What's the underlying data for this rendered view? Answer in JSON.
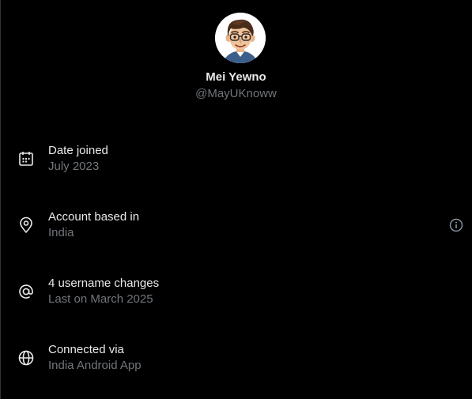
{
  "profile": {
    "display_name": "Mei Yewno",
    "handle": "@MayUKnoww",
    "avatar_icon": "cartoon-avatar"
  },
  "rows": [
    {
      "icon": "calendar-icon",
      "title": "Date joined",
      "subtitle": "July 2023"
    },
    {
      "icon": "location-pin-icon",
      "title": "Account based in",
      "subtitle": "India",
      "has_info": true
    },
    {
      "icon": "at-sign-icon",
      "title": "4 username changes",
      "subtitle": "Last on March 2025"
    },
    {
      "icon": "globe-icon",
      "title": "Connected via",
      "subtitle": "India Android App"
    }
  ],
  "colors": {
    "background": "#000000",
    "primary_text": "#e7e9ea",
    "secondary_text": "#71767b"
  }
}
